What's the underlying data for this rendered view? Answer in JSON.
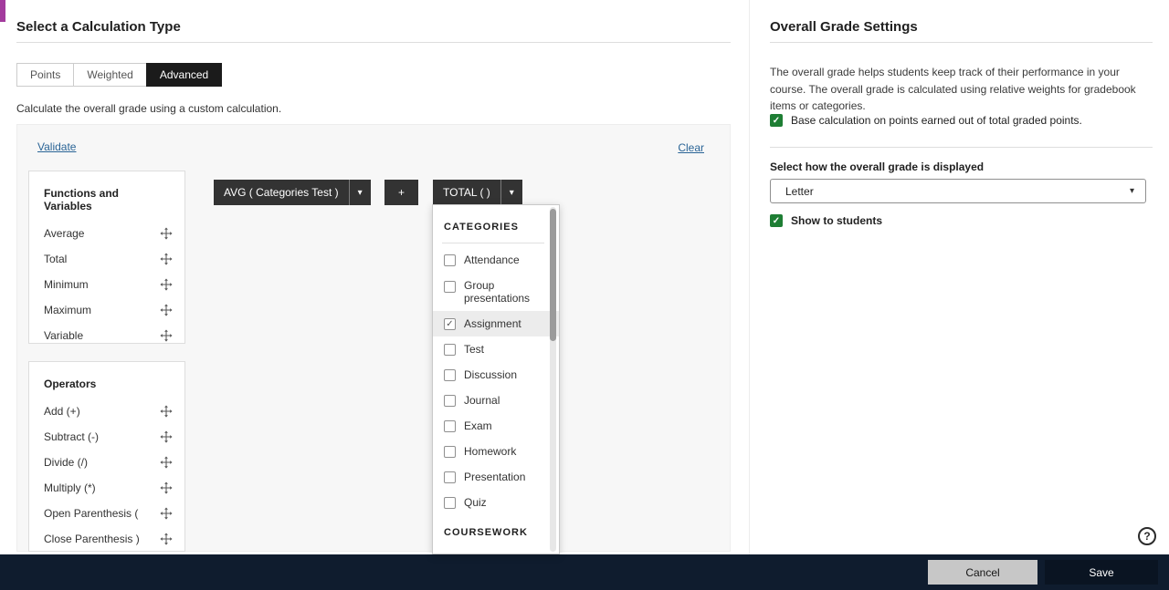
{
  "colors": {
    "accent": "#a33b9d",
    "tab_active_bg": "#1b1b1b",
    "chip_bg": "#333333",
    "checkbox_green": "#1e7e34",
    "footer_bg": "#0f1c2e",
    "link": "#2a6496"
  },
  "icons": {
    "caret_down": "▾",
    "check": "✓",
    "help": "?"
  },
  "left": {
    "title": "Select a Calculation Type",
    "tabs": [
      {
        "label": "Points"
      },
      {
        "label": "Weighted"
      },
      {
        "label": "Advanced"
      }
    ],
    "description": "Calculate the overall grade using a custom calculation.",
    "validate": "Validate",
    "clear": "Clear",
    "functions": {
      "title": "Functions and Variables",
      "items": [
        {
          "label": "Average"
        },
        {
          "label": "Total"
        },
        {
          "label": "Minimum"
        },
        {
          "label": "Maximum"
        },
        {
          "label": "Variable"
        }
      ]
    },
    "operators": {
      "title": "Operators",
      "items": [
        {
          "label": "Add (+)"
        },
        {
          "label": "Subtract (-)"
        },
        {
          "label": "Divide (/)"
        },
        {
          "label": "Multiply (*)"
        },
        {
          "label": "Open Parenthesis ("
        },
        {
          "label": "Close Parenthesis )"
        }
      ]
    },
    "expression": {
      "avg_chip": "AVG ( Categories Test )",
      "plus_chip": "+",
      "total_chip": "TOTAL ( )"
    },
    "dropdown": {
      "section1": "CATEGORIES",
      "items": [
        {
          "label": "Attendance",
          "check": ""
        },
        {
          "label": "Group presentations",
          "check": ""
        },
        {
          "label": "Assignment",
          "check": "✓"
        },
        {
          "label": "Test",
          "check": ""
        },
        {
          "label": "Discussion",
          "check": ""
        },
        {
          "label": "Journal",
          "check": ""
        },
        {
          "label": "Exam",
          "check": ""
        },
        {
          "label": "Homework",
          "check": ""
        },
        {
          "label": "Presentation",
          "check": ""
        },
        {
          "label": "Quiz",
          "check": ""
        }
      ],
      "section2": "COURSEWORK"
    }
  },
  "right": {
    "title": "Overall Grade Settings",
    "description": "The overall grade helps students keep track of their performance in your course. The overall grade is calculated using relative weights for gradebook items or categories.",
    "base_calc": {
      "label": "Base calculation on points earned out of total graded points.",
      "check": "✓"
    },
    "display_label": "Select how the overall grade is displayed",
    "display_value": "Letter",
    "show_students": {
      "label": "Show to students",
      "check": "✓"
    },
    "help": "?"
  },
  "footer": {
    "cancel": "Cancel",
    "save": "Save"
  }
}
